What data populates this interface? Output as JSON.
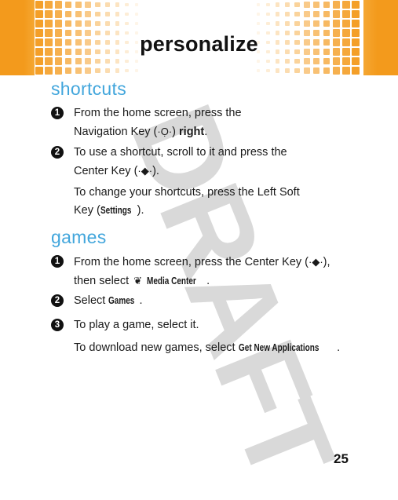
{
  "header": {
    "title": "personalize",
    "accent_color": "#f39a1c"
  },
  "watermark": {
    "text": "DRAFT",
    "letters": [
      "D",
      "R",
      "A",
      "F",
      "T"
    ],
    "color": "#d9d9d9"
  },
  "sections": [
    {
      "heading": "shortcuts",
      "heading_color": "#42a6dc",
      "steps": [
        {
          "number": "1",
          "line1": "From the home screen, press the",
          "line2_prefix": "Navigation Key (",
          "line2_icon": "navigation-key-icon",
          "line2_icon_glyph": "·Ọ·",
          "line2_mid": ") ",
          "line2_bold": "right",
          "line2_suffix": "."
        },
        {
          "number": "2",
          "line1": "To use a shortcut, scroll to it and press the",
          "line2_prefix": "Center Key (",
          "line2_icon": "center-key-icon",
          "line2_icon_glyph": "·◆·",
          "line2_suffix": ")."
        }
      ],
      "note": {
        "line1": "To change your shortcuts, press the Left Soft",
        "line2_prefix": "Key (",
        "line2_term": "Settings",
        "line2_suffix": ")."
      }
    },
    {
      "heading": "games",
      "heading_color": "#42a6dc",
      "steps": [
        {
          "number": "1",
          "line1_prefix": "From the home screen, press the Center Key (",
          "line1_icon": "center-key-icon",
          "line1_icon_glyph": "·◆·",
          "line1_suffix": "),",
          "line2_prefix": "then select ",
          "line2_icon": "media-center-icon",
          "line2_icon_glyph": "❦",
          "line2_term": "Media Center",
          "line2_suffix": "."
        },
        {
          "number": "2",
          "prefix": "Select ",
          "term": "Games",
          "suffix": "."
        },
        {
          "number": "3",
          "text": "To play a game, select it."
        }
      ],
      "note": {
        "prefix": "To download new games, select ",
        "term": "Get New Applications",
        "suffix": "."
      }
    }
  ],
  "page_number": "25"
}
